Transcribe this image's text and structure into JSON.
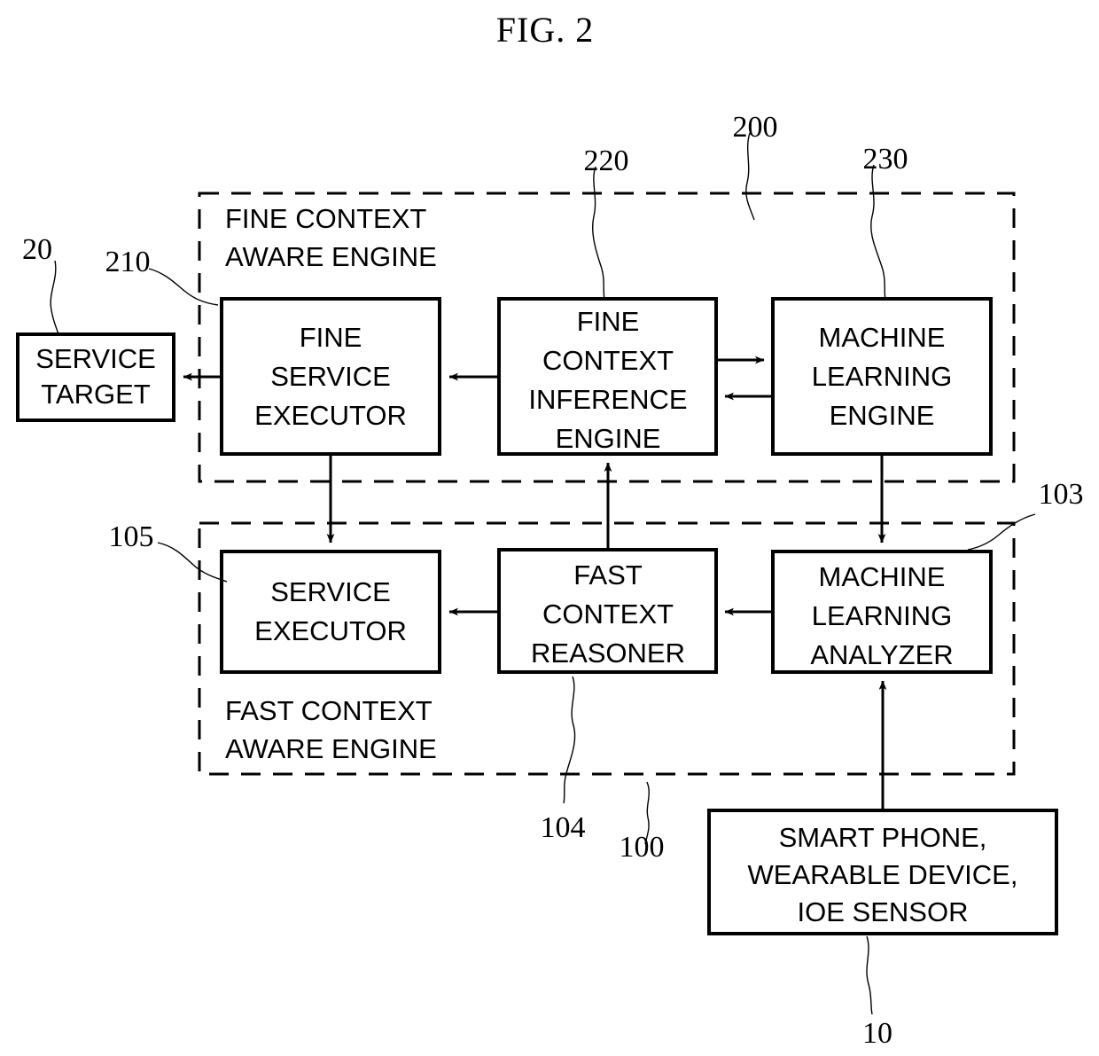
{
  "figure": {
    "title": "FIG. 2",
    "type": "patent-block-diagram"
  },
  "groups": {
    "fine_engine": {
      "label_line1": "FINE CONTEXT",
      "label_line2": "AWARE ENGINE",
      "ref": "200"
    },
    "fast_engine": {
      "label_line1": "FAST CONTEXT",
      "label_line2": "AWARE ENGINE",
      "ref": "100"
    }
  },
  "boxes": {
    "service_target": {
      "line1": "SERVICE",
      "line2": "TARGET",
      "ref": "20"
    },
    "fine_service_executor": {
      "line1": "FINE",
      "line2": "SERVICE",
      "line3": "EXECUTOR",
      "ref": "210"
    },
    "fine_context_inference_engine": {
      "line1": "FINE",
      "line2": "CONTEXT",
      "line3": "INFERENCE",
      "line4": "ENGINE",
      "ref": "220"
    },
    "machine_learning_engine": {
      "line1": "MACHINE",
      "line2": "LEARNING",
      "line3": "ENGINE",
      "ref": "230"
    },
    "service_executor": {
      "line1": "SERVICE",
      "line2": "EXECUTOR",
      "ref": "105"
    },
    "fast_context_reasoner": {
      "line1": "FAST",
      "line2": "CONTEXT",
      "line3": "REASONER",
      "ref": "104"
    },
    "machine_learning_analyzer": {
      "line1": "MACHINE",
      "line2": "LEARNING",
      "line3": "ANALYZER",
      "ref": "103"
    },
    "sensor_devices": {
      "line1": "SMART PHONE,",
      "line2": "WEARABLE DEVICE,",
      "line3": "IOE SENSOR",
      "ref": "10"
    }
  },
  "reference_numerals": {
    "n10": "10",
    "n20": "20",
    "n100": "100",
    "n103": "103",
    "n104": "104",
    "n105": "105",
    "n200": "200",
    "n210": "210",
    "n220": "220",
    "n230": "230"
  },
  "colors": {
    "stroke": "#000000",
    "background": "#ffffff"
  }
}
